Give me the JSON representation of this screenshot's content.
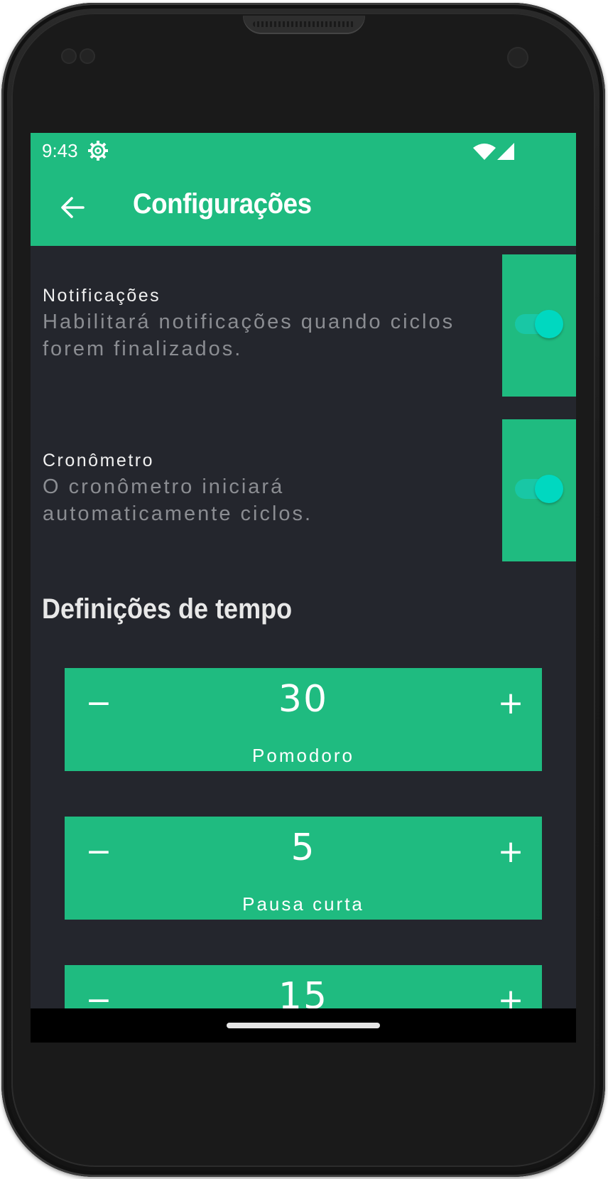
{
  "status_bar": {
    "time": "9:43",
    "icons": [
      "gear-icon",
      "wifi-icon",
      "signal-icon"
    ]
  },
  "app_bar": {
    "title": "Configurações",
    "back_icon": "arrow-left-icon"
  },
  "settings": [
    {
      "title": "Notificações",
      "description": "Habilitará notificações quando ciclos forem finalizados.",
      "enabled": true
    },
    {
      "title": "Cronômetro",
      "description": "O cronômetro iniciará automaticamente ciclos.",
      "enabled": true
    }
  ],
  "time_section": {
    "title": "Definições de tempo",
    "steppers": [
      {
        "value": "30",
        "label": "Pomodoro",
        "minus": "−",
        "plus": "+"
      },
      {
        "value": "5",
        "label": "Pausa curta",
        "minus": "−",
        "plus": "+"
      },
      {
        "value": "15",
        "label": "",
        "minus": "−",
        "plus": "+"
      }
    ]
  },
  "colors": {
    "primary": "#1fbb80",
    "background": "#24262d",
    "switch_thumb": "#00d8c0",
    "description_text": "#8b8d92"
  }
}
